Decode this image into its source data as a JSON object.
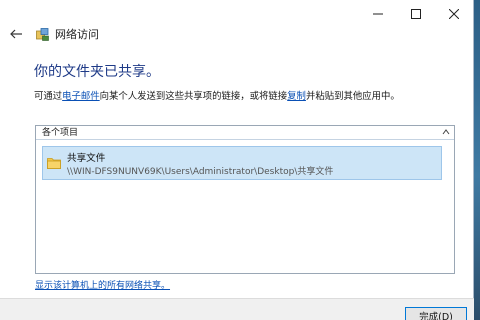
{
  "window": {
    "title": "网络访问",
    "caption_icons": [
      "minimize-icon",
      "maximize-icon",
      "close-icon"
    ]
  },
  "heading": "你的文件夹已共享。",
  "description": {
    "part1": "可通过",
    "link_email": "电子邮件",
    "part2": "向某个人发送到这些共享项的链接，或将链接",
    "link_copy": "复制",
    "part3": "并粘贴到其他应用中。"
  },
  "list": {
    "header": "各个项目",
    "items": [
      {
        "name": "共享文件",
        "path": "\\\\WIN-DFS9NUNV69K\\Users\\Administrator\\Desktop\\共享文件",
        "icon": "folder-icon"
      }
    ]
  },
  "footer_link": "显示该计算机上的所有网络共享。",
  "done_button": "完成(D)",
  "colors": {
    "heading": "#1e3a87",
    "link": "#0a50b5",
    "selection": "#cde5f7",
    "accent": "#0078d7"
  }
}
